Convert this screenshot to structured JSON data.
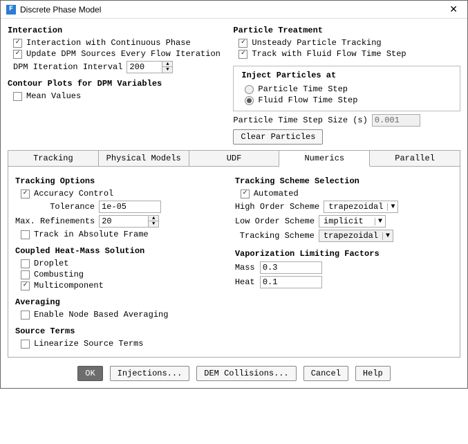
{
  "window": {
    "title": "Discrete Phase Model",
    "icon_letter": "F"
  },
  "interaction": {
    "title": "Interaction",
    "continuous_phase": "Interaction with Continuous Phase",
    "continuous_phase_checked": true,
    "update_sources": "Update DPM Sources Every Flow Iteration",
    "update_sources_checked": true,
    "dpm_iter_label": "DPM Iteration Interval",
    "dpm_iter_value": "200"
  },
  "contour": {
    "title": "Contour Plots for DPM Variables",
    "mean_values": "Mean Values",
    "mean_values_checked": false
  },
  "particle_treatment": {
    "title": "Particle Treatment",
    "unsteady": "Unsteady Particle Tracking",
    "unsteady_checked": true,
    "track_fluid": "Track with Fluid Flow Time Step",
    "track_fluid_checked": true,
    "inject_title": "Inject Particles at",
    "particle_ts": "Particle Time Step",
    "fluid_ts": "Fluid Flow Time Step",
    "selected_inject": "fluid",
    "ts_size_label": "Particle Time Step Size (s)",
    "ts_size_value": "0.001",
    "clear_btn": "Clear Particles"
  },
  "tabs": {
    "items": [
      "Tracking",
      "Physical Models",
      "UDF",
      "Numerics",
      "Parallel"
    ],
    "active": 3
  },
  "tracking_options": {
    "title": "Tracking Options",
    "accuracy": "Accuracy Control",
    "accuracy_checked": true,
    "tolerance_label": "Tolerance",
    "tolerance_value": "1e-05",
    "max_ref_label": "Max. Refinements",
    "max_ref_value": "20",
    "absolute_frame": "Track in Absolute Frame",
    "absolute_frame_checked": false
  },
  "coupled": {
    "title": "Coupled Heat-Mass Solution",
    "droplet": "Droplet",
    "droplet_checked": false,
    "combusting": "Combusting",
    "combusting_checked": false,
    "multi": "Multicomponent",
    "multi_checked": true
  },
  "averaging": {
    "title": "Averaging",
    "node_based": "Enable Node Based Averaging",
    "node_based_checked": false
  },
  "source_terms": {
    "title": "Source Terms",
    "linearize": "Linearize Source Terms",
    "linearize_checked": false
  },
  "tracking_scheme": {
    "title": "Tracking Scheme Selection",
    "automated": "Automated",
    "automated_checked": true,
    "high_label": "High Order Scheme",
    "high_value": "trapezoidal",
    "low_label": "Low Order Scheme",
    "low_value": "implicit",
    "scheme_label": "Tracking Scheme",
    "scheme_value": "trapezoidal"
  },
  "vaporization": {
    "title": "Vaporization Limiting Factors",
    "mass_label": "Mass",
    "mass_value": "0.3",
    "heat_label": "Heat",
    "heat_value": "0.1"
  },
  "buttons": {
    "ok": "OK",
    "injections": "Injections...",
    "dem": "DEM Collisions...",
    "cancel": "Cancel",
    "help": "Help"
  }
}
